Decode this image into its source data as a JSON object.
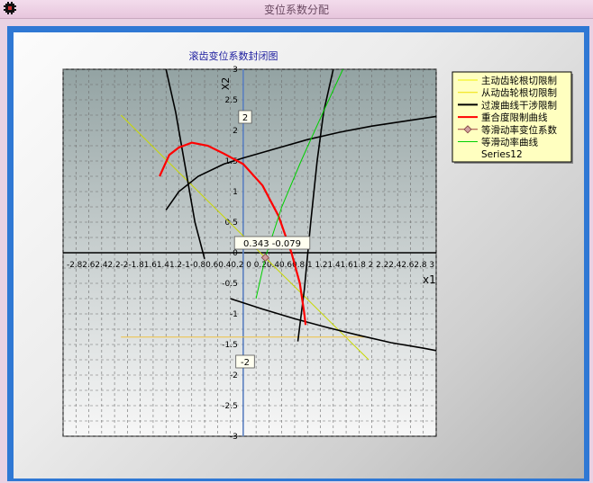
{
  "window": {
    "title": "变位系数分配",
    "icon": "app-icon"
  },
  "chart_data": {
    "type": "line",
    "title": "滚齿变位系数封闭图",
    "xlabel": "x1",
    "ylabel": "X2",
    "xlim": [
      -2.8,
      3
    ],
    "ylim": [
      -3,
      3
    ],
    "x_ticks": [
      "-2.8",
      "-2.6",
      "-2.4",
      "-2.2",
      "-2",
      "-1.8",
      "-1.6",
      "-1.4",
      "-1.2",
      "-1",
      "-0.8",
      "-0.6",
      "-0.4",
      "-0.2",
      "0",
      "0.2",
      "0.4",
      "0.6",
      "0.8",
      "1",
      "1.2",
      "1.4",
      "1.6",
      "1.8",
      "2",
      "2.2",
      "2.4",
      "2.6",
      "2.8",
      "3"
    ],
    "x_tick_text": "-2.82.62.42.2-2-1.81.61.41.2-1-0.80.60.40.2 0 0.20.40.60.8 1 1.21.41.61.8 2 2.22.42.62.8 3",
    "y_ticks": [
      "3",
      "2.5",
      "2",
      "1.5",
      "1",
      "0.5",
      "0",
      "-0.5",
      "-1",
      "-1.5",
      "-2",
      "-2.5",
      "-3"
    ],
    "grid": true,
    "legend_position": "top-right",
    "legend": [
      {
        "name": "主动齿轮根切限制",
        "color": "#f0f000",
        "style": "line"
      },
      {
        "name": "从动齿轮根切限制",
        "color": "#f0e000",
        "style": "line"
      },
      {
        "name": "过渡曲线干涉限制",
        "color": "#000000",
        "style": "line"
      },
      {
        "name": "重合度限制曲线",
        "color": "#ff0000",
        "style": "line"
      },
      {
        "name": "等滑动率变位系数",
        "color": "#a04040",
        "style": "diamond"
      },
      {
        "name": "等滑动率曲线",
        "color": "#00d000",
        "style": "line"
      },
      {
        "name": "Series12",
        "color": "#ffffc0",
        "style": "none"
      }
    ],
    "point_label": "0.343 -0.079",
    "point": {
      "x": 0.343,
      "y": -0.079
    },
    "annotations": [
      "2",
      "-2"
    ],
    "series": [
      {
        "name": "主动齿轮根切限制",
        "color": "#c8d800",
        "x": [
          -1.9,
          1.95
        ],
        "y": [
          2.25,
          -1.75
        ]
      },
      {
        "name": "从动齿轮根切限制",
        "color": "#f0c040",
        "x": [
          -1.9,
          1.95
        ],
        "y": [
          -1.38,
          -1.38
        ]
      },
      {
        "name": "过渡曲线干涉限制",
        "color": "#000000",
        "x": [
          -1.2,
          -1.0,
          -0.7,
          -0.3,
          0,
          0.5,
          1.0,
          1.5,
          2.0,
          2.5,
          3.0
        ],
        "y": [
          0.7,
          1.0,
          1.25,
          1.45,
          1.55,
          1.7,
          1.85,
          1.97,
          2.07,
          2.15,
          2.23
        ]
      },
      {
        "name": "过渡曲线干涉限制",
        "color": "#000000",
        "x": [
          -1.2,
          -1.05,
          -0.9,
          -0.75,
          -0.6
        ],
        "y": [
          3.0,
          2.3,
          1.4,
          0.5,
          -0.1
        ]
      },
      {
        "name": "过渡曲线干涉限制",
        "color": "#000000",
        "x": [
          -0.2,
          0.3,
          0.8,
          1.3,
          1.8,
          2.3,
          2.8,
          3.0
        ],
        "y": [
          -0.75,
          -0.92,
          -1.08,
          -1.22,
          -1.35,
          -1.47,
          -1.56,
          -1.6
        ]
      },
      {
        "name": "过渡曲线干涉限制",
        "color": "#000000",
        "x": [
          0.85,
          0.95,
          1.05,
          1.15,
          1.25,
          1.4
        ],
        "y": [
          -1.45,
          -0.6,
          0.5,
          1.5,
          2.3,
          3.0
        ]
      },
      {
        "name": "重合度限制曲线",
        "color": "#ff0000",
        "x": [
          -1.3,
          -1.15,
          -1.0,
          -0.8,
          -0.55,
          -0.3,
          0,
          0.3,
          0.55,
          0.75,
          0.88,
          0.95,
          0.97
        ],
        "y": [
          1.25,
          1.6,
          1.72,
          1.8,
          1.75,
          1.62,
          1.45,
          1.1,
          0.6,
          0.0,
          -0.5,
          -1.0,
          -1.18
        ]
      },
      {
        "name": "等滑动率曲线",
        "color": "#00d000",
        "x": [
          0.2,
          0.343,
          0.6,
          0.9,
          1.2,
          1.55
        ],
        "y": [
          -0.75,
          -0.079,
          0.75,
          1.5,
          2.2,
          3.0
        ]
      }
    ]
  }
}
